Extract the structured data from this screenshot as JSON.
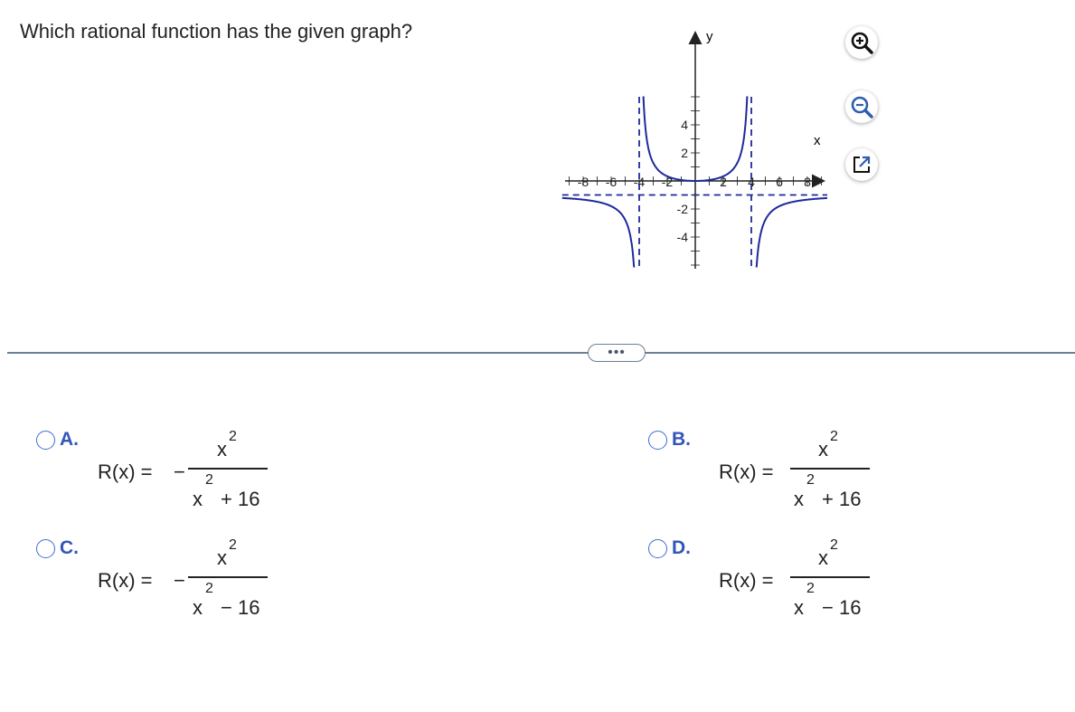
{
  "question": "Which rational function has the given graph?",
  "graph": {
    "x_axis_label": "x",
    "y_axis_label": "y",
    "x_tick_labels": [
      "-8",
      "-6",
      "-4",
      "-2",
      "2",
      "4",
      "6",
      "8"
    ],
    "y_tick_labels": [
      "4",
      "2",
      "-2",
      "-4"
    ],
    "xlim": [
      -10,
      10
    ],
    "ylim": [
      -5,
      5
    ],
    "vertical_asymptotes": [
      -4,
      4
    ],
    "horizontal_asymptote": -1,
    "curve_color": "#1f2a99",
    "asymptote_color": "#1f2a99"
  },
  "toolbar": {
    "zoom_in_icon": "zoom-in-icon",
    "zoom_out_icon": "zoom-out-icon",
    "popout_icon": "popout-icon"
  },
  "more_button": "•••",
  "options": [
    {
      "letter": "A.",
      "lhs": "R(x) =",
      "sign": "−",
      "num_base": "x",
      "num_exp": "2",
      "den_base": "x",
      "den_exp": "2",
      "den_rest": "+ 16"
    },
    {
      "letter": "B.",
      "lhs": "R(x) =",
      "sign": "",
      "num_base": "x",
      "num_exp": "2",
      "den_base": "x",
      "den_exp": "2",
      "den_rest": "+ 16"
    },
    {
      "letter": "C.",
      "lhs": "R(x) =",
      "sign": "−",
      "num_base": "x",
      "num_exp": "2",
      "den_base": "x",
      "den_exp": "2",
      "den_rest": "− 16"
    },
    {
      "letter": "D.",
      "lhs": "R(x) =",
      "sign": "",
      "num_base": "x",
      "num_exp": "2",
      "den_base": "x",
      "den_exp": "2",
      "den_rest": "− 16"
    }
  ],
  "colors": {
    "accent": "#3256b8",
    "divider": "#6d7f94"
  }
}
